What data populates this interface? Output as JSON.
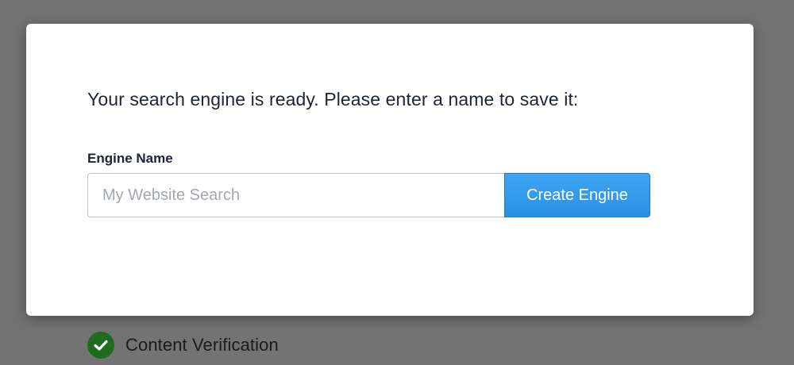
{
  "background": {
    "step": {
      "icon": "checkmark-circle-icon",
      "status_color": "#1f6b1f",
      "label": "Content Verification"
    }
  },
  "modal": {
    "heading": "Your search engine is ready. Please enter a name to save it:",
    "field_label": "Engine Name",
    "input": {
      "value": "",
      "placeholder": "My Website Search"
    },
    "button_label": "Create Engine",
    "accent_color": "#2a8fe4"
  }
}
